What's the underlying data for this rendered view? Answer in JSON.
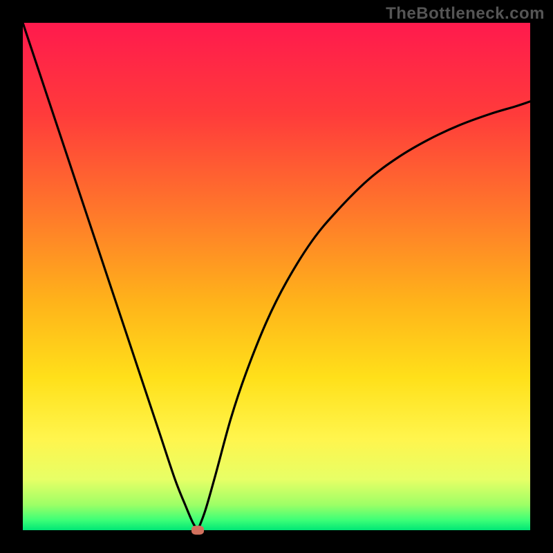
{
  "watermark": "TheBottleneck.com",
  "chart_data": {
    "type": "line",
    "title": "",
    "xlabel": "",
    "ylabel": "",
    "xlim": [
      0,
      100
    ],
    "ylim": [
      0,
      100
    ],
    "gradient_stops": [
      {
        "pct": 0,
        "color": "#ff1a4d"
      },
      {
        "pct": 18,
        "color": "#ff3b3b"
      },
      {
        "pct": 38,
        "color": "#ff7a2a"
      },
      {
        "pct": 55,
        "color": "#ffb31a"
      },
      {
        "pct": 70,
        "color": "#ffe01a"
      },
      {
        "pct": 82,
        "color": "#fff54d"
      },
      {
        "pct": 90,
        "color": "#e7ff66"
      },
      {
        "pct": 95,
        "color": "#9dff66"
      },
      {
        "pct": 98,
        "color": "#3dff77"
      },
      {
        "pct": 100,
        "color": "#00e676"
      }
    ],
    "series": [
      {
        "name": "left-branch",
        "x": [
          0.0,
          3.0,
          6.0,
          9.0,
          12.0,
          15.0,
          18.0,
          21.0,
          24.0,
          27.0,
          30.0,
          32.0,
          33.5,
          34.5
        ],
        "y": [
          100.0,
          91.0,
          82.0,
          73.0,
          64.0,
          55.0,
          46.0,
          37.0,
          28.0,
          19.0,
          10.0,
          5.0,
          1.5,
          0.0
        ]
      },
      {
        "name": "right-branch",
        "x": [
          34.5,
          36.0,
          38.0,
          41.0,
          44.0,
          48.0,
          52.0,
          57.0,
          62.0,
          68.0,
          74.0,
          80.0,
          86.0,
          92.0,
          97.0,
          100.0
        ],
        "y": [
          0.0,
          4.0,
          11.0,
          22.0,
          31.0,
          41.0,
          49.0,
          57.0,
          63.0,
          69.0,
          73.5,
          77.0,
          79.8,
          82.0,
          83.5,
          84.5
        ]
      }
    ],
    "marker": {
      "x": 34.5,
      "y": 0.0,
      "color": "#d1705d"
    },
    "annotations": []
  }
}
